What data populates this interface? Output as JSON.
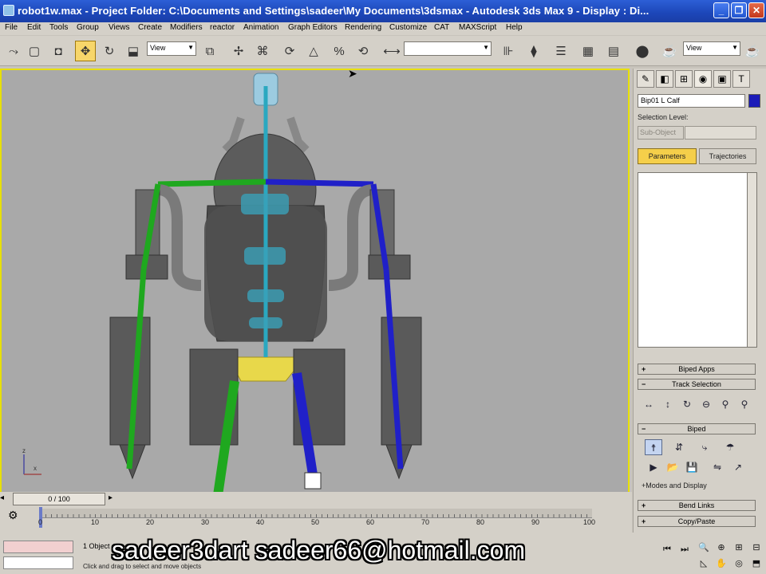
{
  "window": {
    "title": "robot1w.max    - Project Folder: C:\\Documents and Settings\\sadeer\\My Documents\\3dsmax    - Autodesk 3ds Max 9         - Display : Di..."
  },
  "menu": [
    "File",
    "Edit",
    "Tools",
    "Group",
    "Views",
    "Create",
    "Modifiers",
    "reactor",
    "Animation",
    "Graph Editors",
    "Rendering",
    "Customize",
    "CAT",
    "MAXScript",
    "Help"
  ],
  "toolbar": {
    "ref_coord": "View",
    "named_sel": "",
    "view2": "View"
  },
  "command_panel": {
    "object_name": "Bip01 L Calf",
    "selection_level_label": "Selection Level:",
    "sub_object": "Sub-Object",
    "tab_parameters": "Parameters",
    "tab_trajectories": "Trajectories",
    "rollouts": {
      "biped_apps": "Biped Apps",
      "track_selection": "Track Selection",
      "biped": "Biped",
      "modes_display": "Modes and Display",
      "bend_links": "Bend Links",
      "copy_paste": "Copy/Paste"
    }
  },
  "timeline": {
    "slider": "0 / 100",
    "ticks": [
      "0",
      "10",
      "20",
      "30",
      "40",
      "50",
      "60",
      "70",
      "80",
      "90",
      "100"
    ]
  },
  "status": {
    "selection": "1 Object",
    "prompt": "Click and drag to select and move objects"
  },
  "watermark": "sadeer3dart  sadeer66@hotmail.com",
  "colors": {
    "viewport_border": "#e8e000",
    "left_limb": "#1fa81f",
    "right_limb": "#2020c8",
    "spine": "#2aa8c0",
    "pelvis": "#e8d84a"
  }
}
